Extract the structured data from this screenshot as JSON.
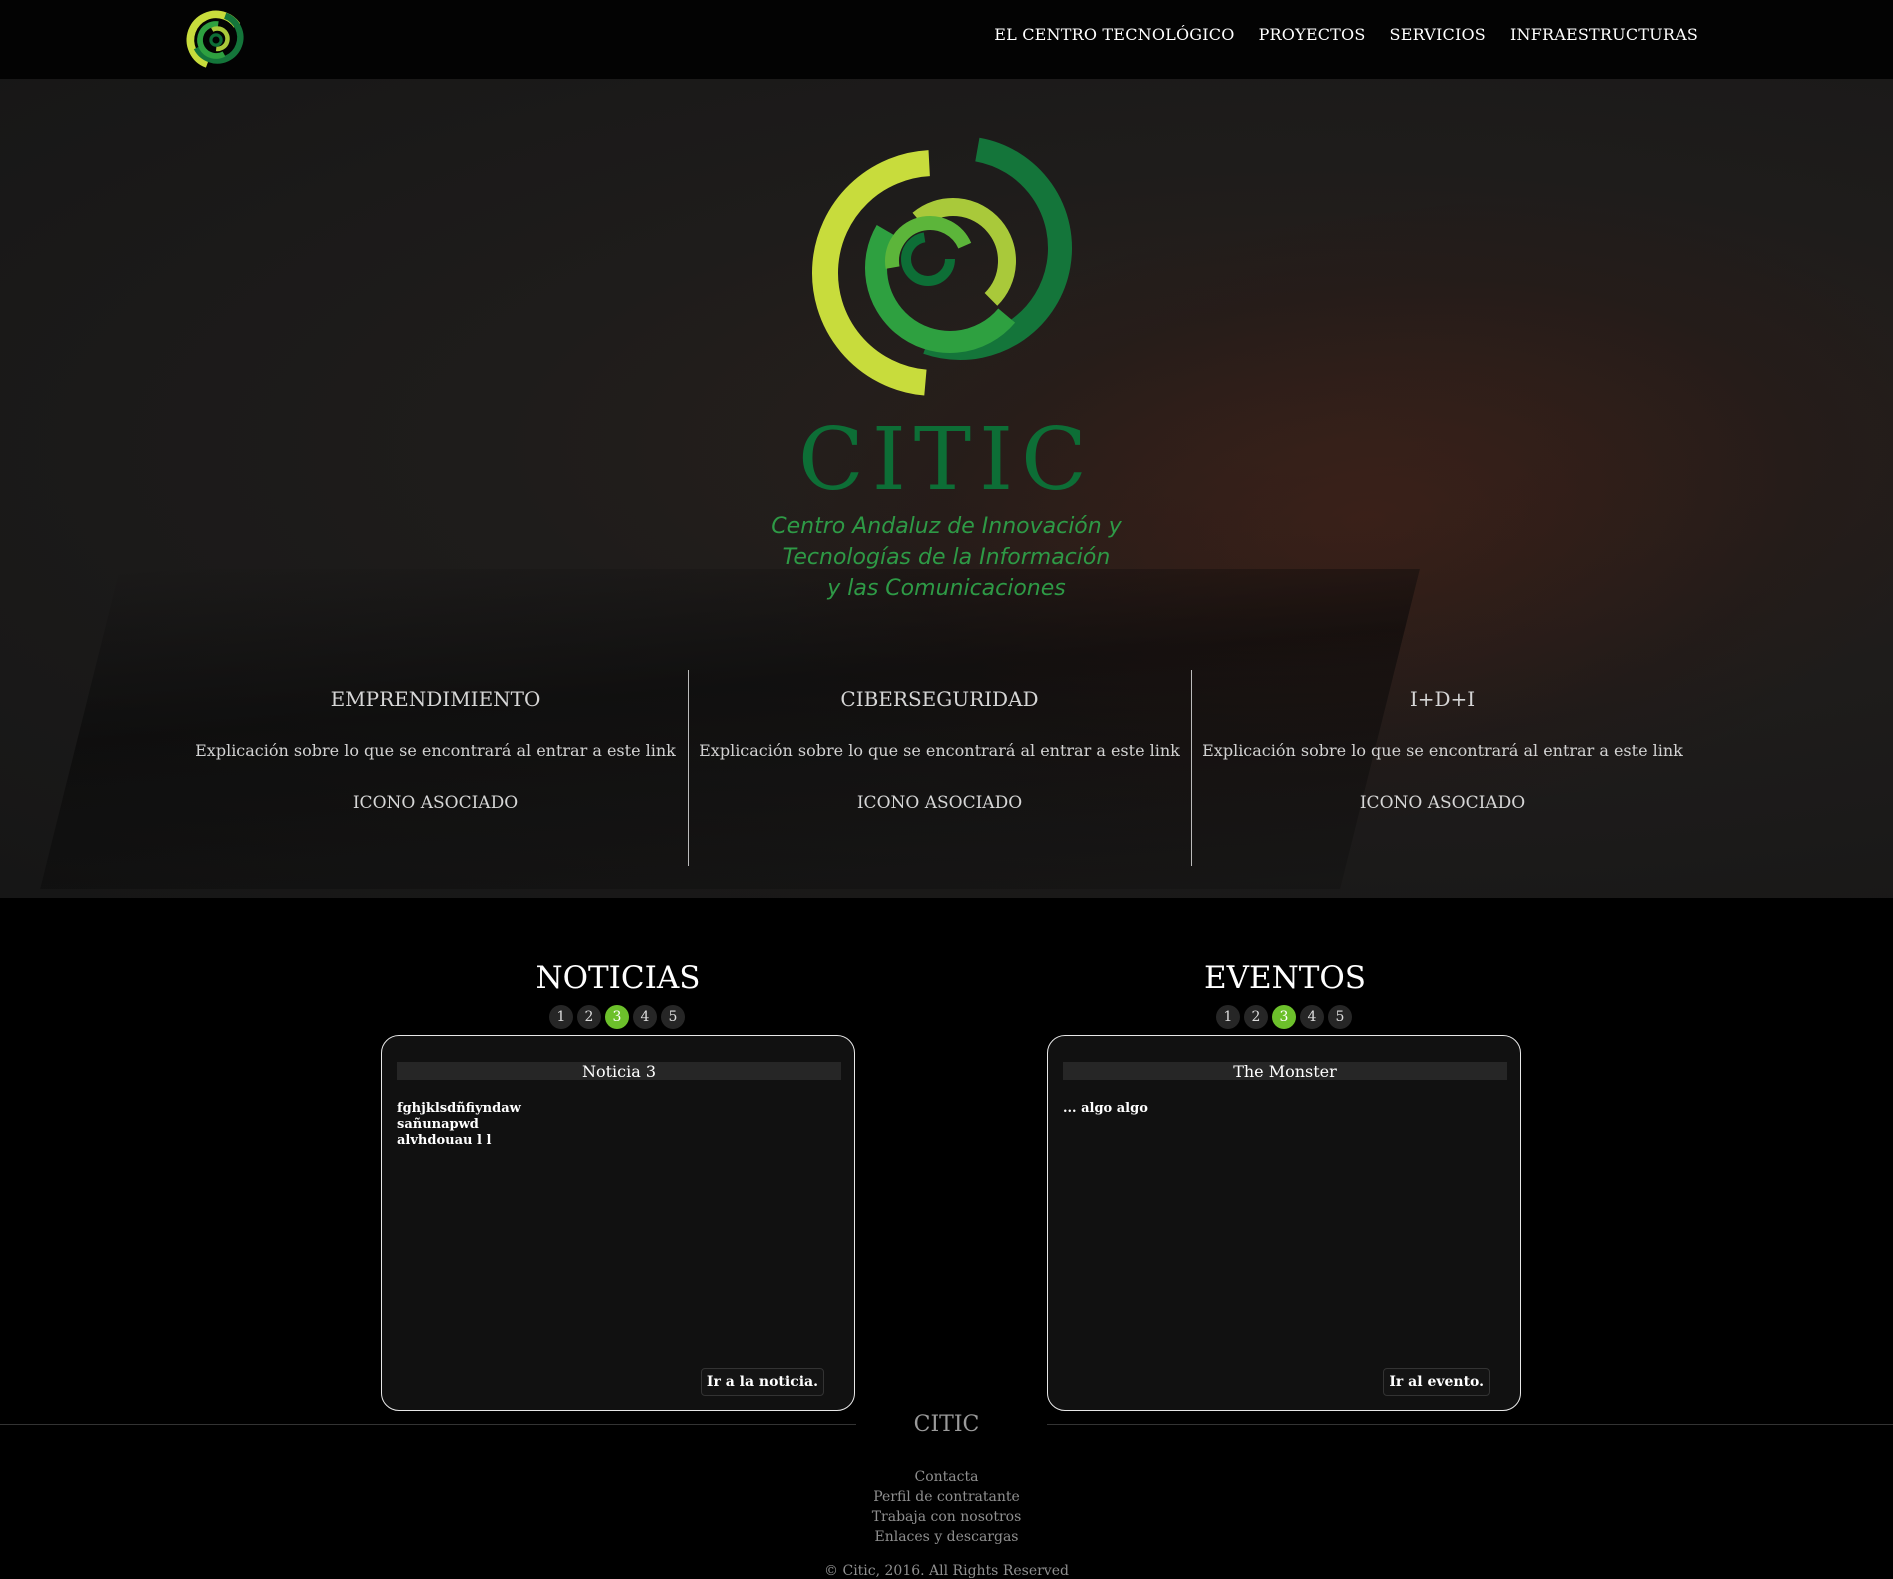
{
  "nav": {
    "items": [
      {
        "label": "EL CENTRO TECNOLÓGICO"
      },
      {
        "label": "PROYECTOS"
      },
      {
        "label": "SERVICIOS"
      },
      {
        "label": "INFRAESTRUCTURAS"
      }
    ]
  },
  "hero": {
    "brand": "CITIC",
    "subtitle_lines": [
      "Centro Andaluz de Innovación y",
      "Tecnologías de la Información",
      "y las Comunicaciones"
    ],
    "features": [
      {
        "title": "EMPRENDIMIENTO",
        "text": "Explicación sobre lo que se encontrará al entrar a este link",
        "icon_label": "ICONO ASOCIADO"
      },
      {
        "title": "CIBERSEGURIDAD",
        "text": "Explicación sobre lo que se encontrará al entrar a este link",
        "icon_label": "ICONO ASOCIADO"
      },
      {
        "title": "I+D+I",
        "text": "Explicación sobre lo que se encontrará al entrar a este link",
        "icon_label": "ICONO ASOCIADO"
      }
    ]
  },
  "news": {
    "title": "NOTICIAS",
    "pages": [
      "1",
      "2",
      "3",
      "4",
      "5"
    ],
    "active_page": 3,
    "card_title": "Noticia 3",
    "card_body": "fghjklsdñfiyndaw\nsañunapwd\nalvhdouau l l",
    "button": "Ir a la noticia."
  },
  "events": {
    "title": "EVENTOS",
    "pages": [
      "1",
      "2",
      "3",
      "4",
      "5"
    ],
    "active_page": 3,
    "card_title": "The Monster",
    "card_body": "... algo algo",
    "button": "Ir al evento."
  },
  "footer": {
    "brand": "CITIC",
    "links": [
      "Contacta",
      "Perfil de contratante",
      "Trabaja con nosotros",
      "Enlaces y descargas"
    ],
    "copyright": "© Citic, 2016. All Rights Reserved"
  },
  "colors": {
    "accent_green": "#6cc02b",
    "brand_dark_green": "#0d6e36",
    "brand_light_green": "#c8dc3c"
  },
  "icons": {
    "logo": "citic-spiral-logo-icon"
  }
}
